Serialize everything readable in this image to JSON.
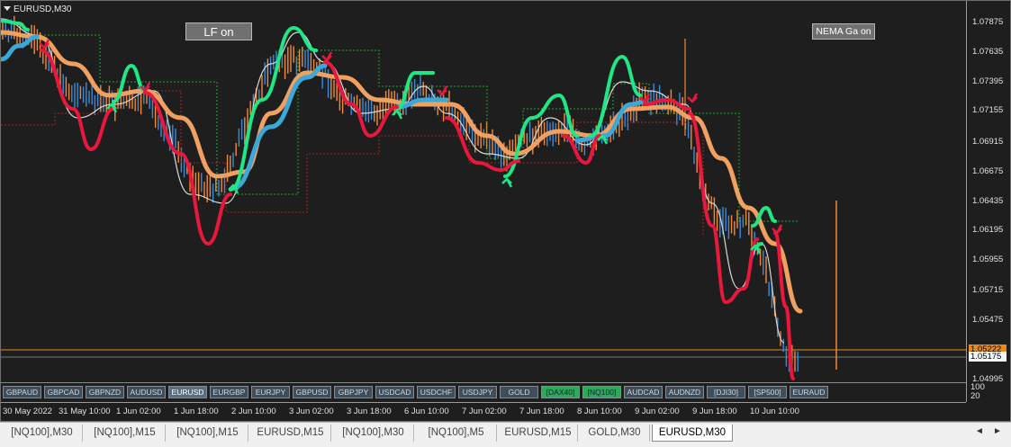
{
  "chart": {
    "symbol_title": "EURUSD,M30",
    "lf_button": "LF on",
    "nema_button": "NEMA Ga on",
    "price_labels": [
      "1.07875",
      "1.07635",
      "1.07395",
      "1.07155",
      "1.06915",
      "1.06675",
      "1.06435",
      "1.06195",
      "1.05955",
      "1.05715",
      "1.05475",
      "1.04995"
    ],
    "current_price_tag": "1.05222",
    "bid_price_tag": "1.05175",
    "sub_window_scale": [
      "100",
      "20"
    ],
    "time_labels": [
      "30 May 2022",
      "31 May 10:00",
      "1 Jun 02:00",
      "1 Jun 18:00",
      "2 Jun 10:00",
      "3 Jun 02:00",
      "3 Jun 18:00",
      "6 Jun 10:00",
      "7 Jun 02:00",
      "7 Jun 18:00",
      "8 Jun 10:00",
      "9 Jun 02:00",
      "9 Jun 18:00",
      "10 Jun 10:00"
    ],
    "colors": {
      "background": "#1e1e1e",
      "bull_candle": "#3d8bd9",
      "bear_candle": "#f08a3a",
      "up_curve": "#1ee885",
      "down_curve": "#e8173c",
      "ema_fast": "#3ba8d8",
      "ema_slow": "#f0a060",
      "price_line": "#e88a1a"
    }
  },
  "symbol_buttons": [
    {
      "label": "GBPAUD",
      "state": "normal"
    },
    {
      "label": "GBPCAD",
      "state": "normal"
    },
    {
      "label": "GBPNZD",
      "state": "normal"
    },
    {
      "label": "AUDUSD",
      "state": "normal"
    },
    {
      "label": "EURUSD",
      "state": "active"
    },
    {
      "label": "EURGBP",
      "state": "normal"
    },
    {
      "label": "EURJPY",
      "state": "normal"
    },
    {
      "label": "GBPUSD",
      "state": "normal"
    },
    {
      "label": "GBPJPY",
      "state": "normal"
    },
    {
      "label": "USDCAD",
      "state": "normal"
    },
    {
      "label": "USDCHF",
      "state": "normal"
    },
    {
      "label": "USDJPY",
      "state": "normal"
    },
    {
      "label": "GOLD",
      "state": "normal"
    },
    {
      "label": "[DAX40]",
      "state": "green"
    },
    {
      "label": "[NQ100]",
      "state": "green"
    },
    {
      "label": "AUDCAD",
      "state": "normal"
    },
    {
      "label": "AUDNZD",
      "state": "normal"
    },
    {
      "label": "[DJI30]",
      "state": "normal"
    },
    {
      "label": "[SP500]",
      "state": "normal"
    },
    {
      "label": "EURAUD",
      "state": "normal"
    }
  ],
  "tabs": [
    {
      "label": "[NQ100],M30",
      "active": false
    },
    {
      "label": "[NQ100],M15",
      "active": false
    },
    {
      "label": "[NQ100],M15",
      "active": false
    },
    {
      "label": "EURUSD,M15",
      "active": false
    },
    {
      "label": "[NQ100],M30",
      "active": false
    },
    {
      "label": "[NQ100],M5",
      "active": false
    },
    {
      "label": "EURUSD,M15",
      "active": false
    },
    {
      "label": "GOLD,M30",
      "active": false
    },
    {
      "label": "EURUSD,M30",
      "active": true
    }
  ],
  "tab_arrows": {
    "left": "◄",
    "right": "►"
  }
}
